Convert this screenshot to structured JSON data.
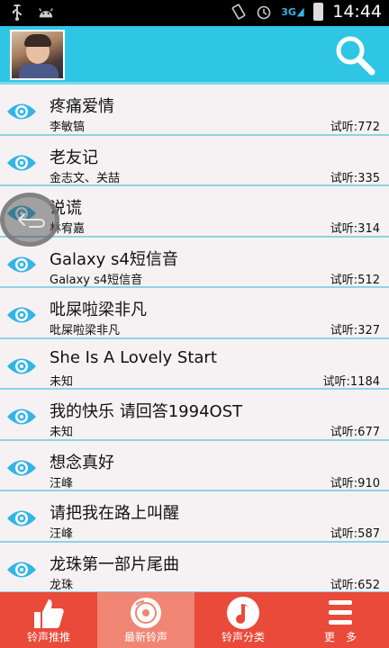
{
  "status_bar": {
    "time": "14:44",
    "network": "3G",
    "icons": [
      "usb-icon",
      "android-icon",
      "vibrate-icon",
      "alarm-icon",
      "signal-icon",
      "battery-icon"
    ]
  },
  "header": {
    "avatar": "avatar",
    "search_icon": "search-icon"
  },
  "ringtones": [
    {
      "title": "疼痛爱情",
      "artist": "李敏镐",
      "plays_label": "试听:",
      "plays": "772"
    },
    {
      "title": "老友记",
      "artist": "金志文、关喆",
      "plays_label": "试听:",
      "plays": "335"
    },
    {
      "title": "说谎",
      "artist": "林宥嘉",
      "plays_label": "试听:",
      "plays": "314"
    },
    {
      "title": "Galaxy s4短信音",
      "artist": "Galaxy s4短信音",
      "plays_label": "试听:",
      "plays": "512"
    },
    {
      "title": "吡屎啦梁非凡",
      "artist": "吡屎啦梁非凡",
      "plays_label": "试听:",
      "plays": "327"
    },
    {
      "title": "She Is A Lovely Start",
      "artist": "未知",
      "plays_label": "试听:",
      "plays": "1184"
    },
    {
      "title": "我的快乐 请回答1994OST",
      "artist": "未知",
      "plays_label": "试听:",
      "plays": "677"
    },
    {
      "title": "想念真好",
      "artist": "汪峰",
      "plays_label": "试听:",
      "plays": "910"
    },
    {
      "title": "请把我在路上叫醒",
      "artist": "汪峰",
      "plays_label": "试听:",
      "plays": "587"
    },
    {
      "title": "龙珠第一部片尾曲",
      "artist": "龙珠",
      "plays_label": "试听:",
      "plays": "652"
    }
  ],
  "bottom_nav": [
    {
      "label": "铃声推推",
      "icon": "thumbs-up-icon",
      "active": false
    },
    {
      "label": "最新铃声",
      "icon": "disc-icon",
      "active": true
    },
    {
      "label": "铃声分类",
      "icon": "music-note-icon",
      "active": false
    },
    {
      "label": "更　多",
      "icon": "menu-icon",
      "active": false
    }
  ],
  "colors": {
    "header": "#2fc6e6",
    "accent": "#33b5e5",
    "bottom_nav": "#e94a3a",
    "bottom_nav_active": "#f08574",
    "divider": "#8dd3e6"
  }
}
